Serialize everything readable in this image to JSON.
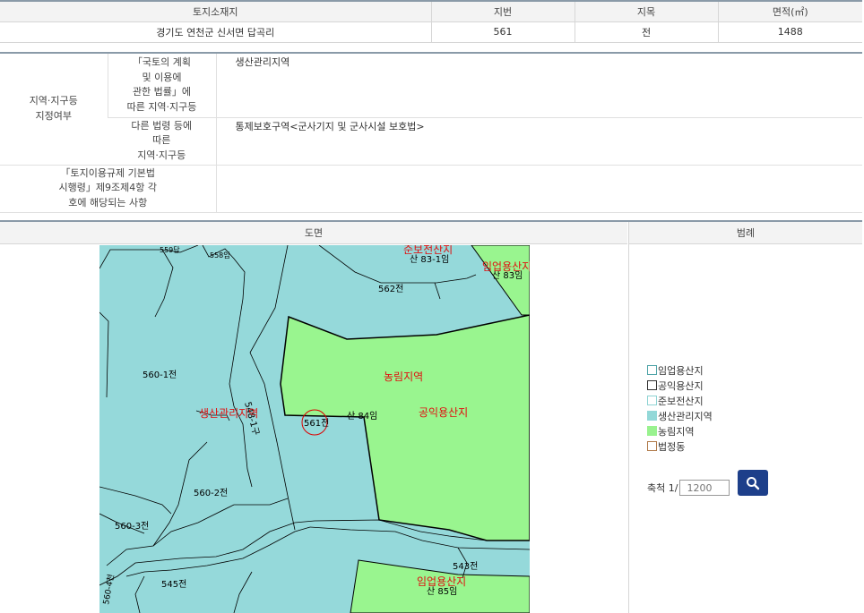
{
  "parcel_table": {
    "headers": [
      "토지소재지",
      "지번",
      "지목",
      "면적(㎡)"
    ],
    "row": [
      "경기도 연천군 신서면 답곡리",
      "561",
      "전",
      "1488"
    ]
  },
  "zoning_table": {
    "main_label": "지역·지구등\n지정여부",
    "sub1_label": "「국토의 계획\n및 이용에\n관한 법률」에\n따른 지역·지구등",
    "sub1_value": "생산관리지역",
    "sub2_label": "다른 법령 등에\n따른\n지역·지구등",
    "sub2_value": "통제보호구역<군사기지 및 군사시설 보호법>",
    "row3_label": "「토지이용규제 기본법\n시행령」제9조제4항 각\n호에 해당되는 사항",
    "row3_value": ""
  },
  "map_section": {
    "map_header": "도면",
    "legend_header": "범례",
    "map_labels": {
      "lot_559": "559답",
      "lot_558": "558임",
      "lot_83_1": "산 83-1임",
      "lot_83": "산 83임",
      "lot_562": "562전",
      "lot_560_1": "560-1전",
      "lot_561": "561전",
      "lot_84": "산 84임",
      "lot_560_2": "560-2전",
      "lot_560_3": "560-3전",
      "lot_560_4": "560-4천",
      "lot_545": "545전",
      "lot_543": "543전",
      "lot_85": "산 85임",
      "lot_road": "548-1구",
      "zone_conserve_forest": "준보전산지",
      "zone_forestry_top": "임업용산지",
      "zone_agri_forest": "농림지역",
      "zone_public_forest": "공익용산지",
      "zone_prod_mgmt": "생산관리지역",
      "zone_forestry_bottom": "임업용산지"
    },
    "legend": [
      {
        "label": "임업용산지",
        "fill": "#ffffff",
        "border": "#4fa4a8"
      },
      {
        "label": "공익용산지",
        "fill": "#ffffff",
        "border": "#333333"
      },
      {
        "label": "준보전산지",
        "fill": "#ffffff",
        "border": "#8fd3d3"
      },
      {
        "label": "생산관리지역",
        "fill": "#93d8d8",
        "border": "#93d8d8"
      },
      {
        "label": "농림지역",
        "fill": "#99f28f",
        "border": "#99f28f"
      },
      {
        "label": "법정동",
        "fill": "#ffffff",
        "border": "#b07a4a"
      }
    ],
    "scale_label": "축척 1/",
    "scale_placeholder": "1200",
    "search_icon": "search-icon"
  },
  "colors": {
    "teal_zone": "#95d9da",
    "green_zone": "#99f58f",
    "label_red": "#e01010",
    "button_blue": "#1d3f8a"
  }
}
